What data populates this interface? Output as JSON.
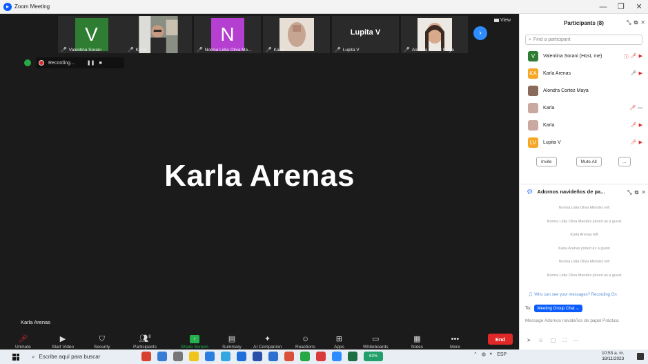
{
  "window": {
    "title": "Zoom Meeting",
    "min": "—",
    "restore": "❐",
    "close": "✕"
  },
  "strip": {
    "tiles": [
      {
        "name": "Valentina Sorani",
        "letter": "V",
        "color": "#2e7d32"
      },
      {
        "name": "Karla"
      },
      {
        "name": "Norma Lidia Oliva Me...",
        "letter": "N",
        "color": "#b43fd0"
      },
      {
        "name": "Karla"
      },
      {
        "name": "Lupita V",
        "bigname": "Lupita V"
      },
      {
        "name": "Alondra Cortez Maya"
      }
    ],
    "view_label": "View"
  },
  "recording": {
    "label": "Recording...",
    "pause": "❚❚",
    "stop": "■"
  },
  "active_speaker": "Karla Arenas",
  "speaker_label": "Karla Arenas",
  "toolbar": {
    "unmute": "Unmute",
    "start_video": "Start Video",
    "security": "Security",
    "participants": "Participants",
    "participants_count": "8",
    "share_screen": "Share Screen",
    "summary": "Summary",
    "ai_companion": "AI Companion",
    "reactions": "Reactions",
    "apps": "Apps",
    "whiteboards": "Whiteboards",
    "notes": "Notes",
    "more": "More",
    "end": "End"
  },
  "participants_panel": {
    "title": "Participants (8)",
    "search_placeholder": "Find a participant",
    "list": [
      {
        "name": "Valentina Sorani (Host, me)",
        "initials": "V",
        "color": "#2e7d32"
      },
      {
        "name": "Karla Arenas",
        "initials": "KA",
        "color": "#f5a623"
      },
      {
        "name": "Alondra Cortez Maya",
        "initials": "",
        "color": "#8a6a5a"
      },
      {
        "name": "Karla",
        "initials": "",
        "color": "#c9a9a0"
      },
      {
        "name": "Karla",
        "initials": "",
        "color": "#c9a9a0"
      },
      {
        "name": "Lupita V",
        "initials": "LV",
        "color": "#f5a623"
      }
    ],
    "invite": "Invite",
    "mute_all": "Mute All",
    "more": "..."
  },
  "chat_panel": {
    "title": "Adornos navideños de pa...",
    "messages": [
      "Norma Lidia Oliva Mendez left",
      "Norma Lidia Oliva Mendez joined as a guest",
      "Karla Arenas left",
      "Karla Arenas joined as a guest",
      "Norma Lidia Oliva Mendez left",
      "Norma Lidia Oliva Mendez joined as a guest"
    ],
    "who_can_see": "Who can see your messages? Recording On",
    "to_label": "To:",
    "to_value": "Meeting Group Chat",
    "input_placeholder": "Message Adornos navideños de papel Práctica"
  },
  "taskbar": {
    "search_placeholder": "Escribe aquí para buscar",
    "battery": "63%",
    "lang": "ESP",
    "time": "10:53 a. m.",
    "date": "18/11/2023"
  }
}
